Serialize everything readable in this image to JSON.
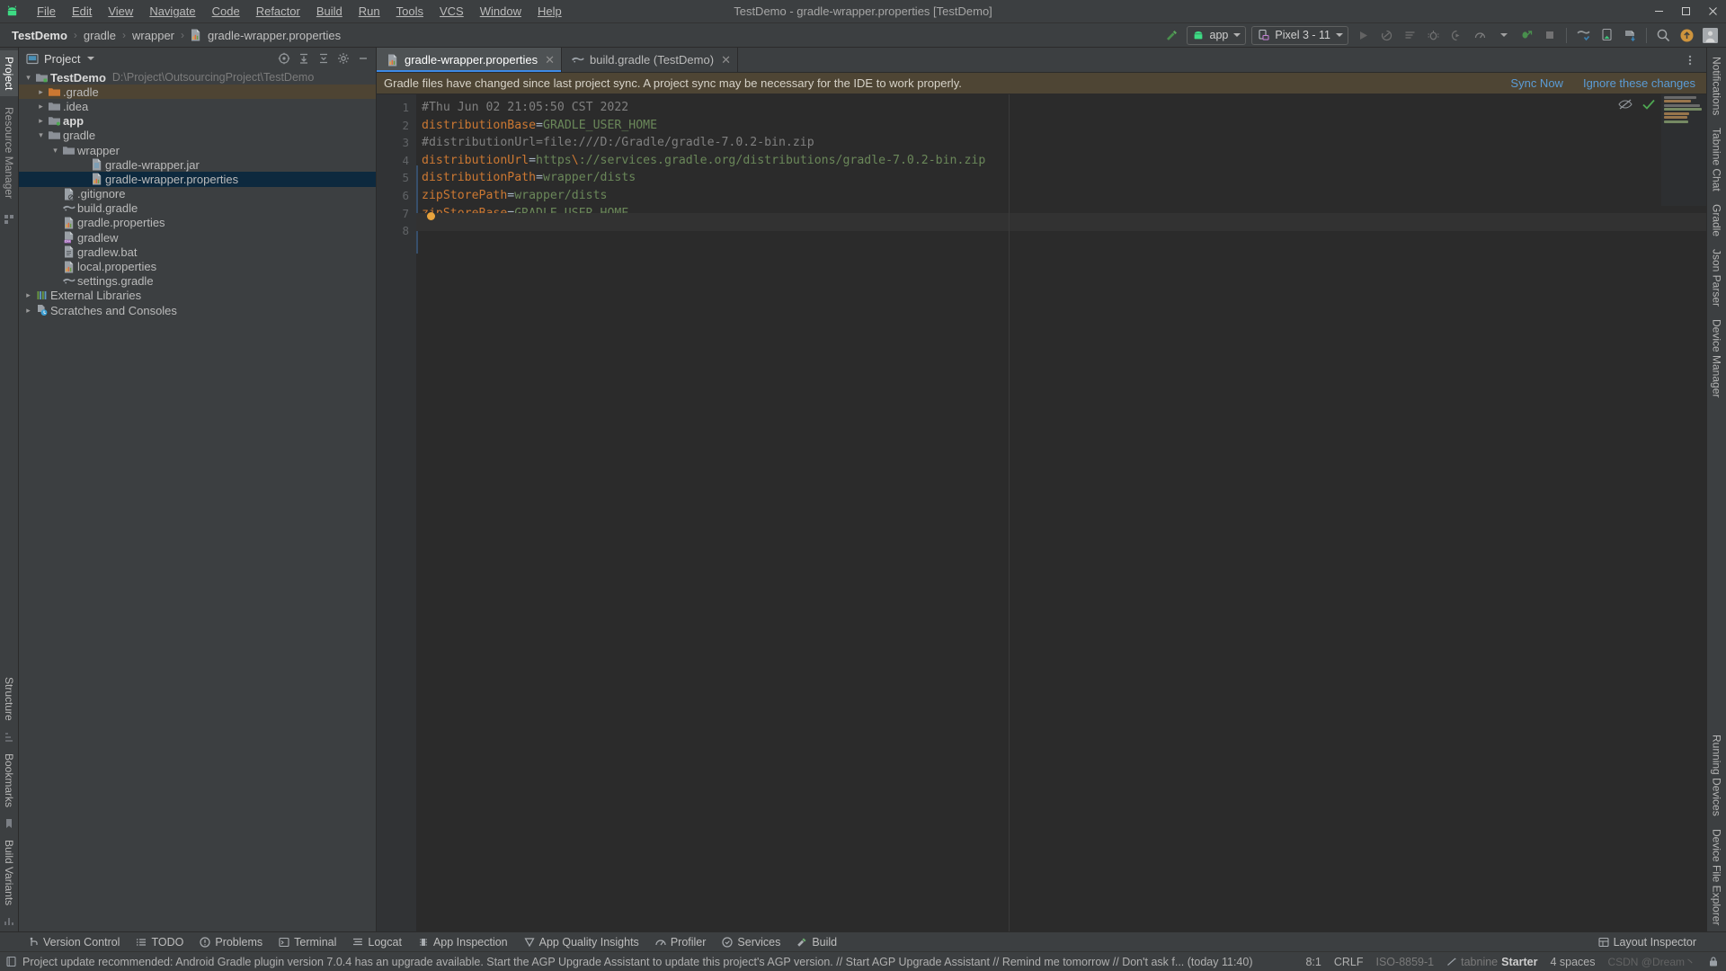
{
  "window": {
    "title": "TestDemo - gradle-wrapper.properties [TestDemo]",
    "minimize": "—",
    "maximize": "☐",
    "close": "✕"
  },
  "menu": [
    {
      "label": "File"
    },
    {
      "label": "Edit"
    },
    {
      "label": "View"
    },
    {
      "label": "Navigate"
    },
    {
      "label": "Code"
    },
    {
      "label": "Refactor"
    },
    {
      "label": "Build"
    },
    {
      "label": "Run"
    },
    {
      "label": "Tools"
    },
    {
      "label": "VCS"
    },
    {
      "label": "Window"
    },
    {
      "label": "Help"
    }
  ],
  "breadcrumb": {
    "separator": "›",
    "items": [
      {
        "label": "TestDemo",
        "bold": true
      },
      {
        "label": "gradle",
        "bold": false
      },
      {
        "label": "wrapper",
        "bold": false
      },
      {
        "label": "gradle-wrapper.properties",
        "bold": false,
        "icon": "properties-file-icon"
      }
    ]
  },
  "toolbar": {
    "build_icon": "hammer-icon",
    "run_config": {
      "label": "app",
      "icon": "android-icon"
    },
    "device": {
      "label": "Pixel 3 - 11",
      "icon": "device-icon"
    },
    "icons": [
      "run-icon",
      "apply-changes-icon",
      "apply-code-changes-icon",
      "debug-icon",
      "run-with-coverage-icon",
      "profile-icon",
      "profile-dropdown-icon",
      "attach-debugger-icon",
      "stop-icon",
      "sdk-manager-icon",
      "avd-manager-icon",
      "sync-gradle-icon",
      "search-icon",
      "update-available-icon",
      "user-avatar-icon"
    ]
  },
  "left_rail": {
    "tabs": [
      {
        "label": "Project",
        "active": true
      }
    ],
    "bottom_tabs": [
      {
        "label": "Structure"
      },
      {
        "label": "Bookmarks"
      },
      {
        "label": "Build Variants"
      }
    ]
  },
  "right_rail": {
    "tabs": [
      {
        "label": "Notifications"
      },
      {
        "label": "Tabnine Chat"
      },
      {
        "label": "Gradle"
      },
      {
        "label": "Json Parser"
      },
      {
        "label": "Device Manager"
      }
    ],
    "bottom_tabs": [
      {
        "label": "Running Devices"
      },
      {
        "label": "Device File Explorer"
      }
    ]
  },
  "project_panel": {
    "title": "Project",
    "title_icon": "project-view-icon",
    "dropdown_icon": "chevron-down-icon",
    "header_icons": [
      "select-opened-file-icon",
      "expand-all-icon",
      "collapse-all-icon",
      "settings-icon",
      "hide-icon"
    ],
    "tree": [
      {
        "depth": 0,
        "label": "TestDemo",
        "path": "D:\\Project\\OutsourcingProject\\TestDemo",
        "arrow": "open",
        "icon": "module-icon",
        "bold": true,
        "state": "normal"
      },
      {
        "depth": 1,
        "label": ".gradle",
        "arrow": "closed",
        "icon": "folder-orange-icon",
        "state": "highlighted"
      },
      {
        "depth": 1,
        "label": ".idea",
        "arrow": "closed",
        "icon": "folder-icon",
        "state": "normal"
      },
      {
        "depth": 1,
        "label": "app",
        "arrow": "closed",
        "icon": "module-folder-icon",
        "bold": true,
        "state": "normal"
      },
      {
        "depth": 1,
        "label": "gradle",
        "arrow": "open",
        "icon": "folder-icon",
        "state": "normal"
      },
      {
        "depth": 2,
        "label": "wrapper",
        "arrow": "open",
        "icon": "folder-icon",
        "state": "normal"
      },
      {
        "depth": 3,
        "label": "gradle-wrapper.jar",
        "arrow": "none",
        "icon": "jar-file-icon",
        "state": "normal"
      },
      {
        "depth": 3,
        "label": "gradle-wrapper.properties",
        "arrow": "none",
        "icon": "properties-file-icon",
        "state": "selected"
      },
      {
        "depth": 1,
        "label": ".gitignore",
        "arrow": "none",
        "icon": "gitignore-file-icon",
        "state": "normal"
      },
      {
        "depth": 1,
        "label": "build.gradle",
        "arrow": "none",
        "icon": "gradle-file-icon",
        "state": "normal"
      },
      {
        "depth": 1,
        "label": "gradle.properties",
        "arrow": "none",
        "icon": "properties-file-icon",
        "state": "normal"
      },
      {
        "depth": 1,
        "label": "gradlew",
        "arrow": "none",
        "icon": "cpp-file-icon",
        "state": "normal"
      },
      {
        "depth": 1,
        "label": "gradlew.bat",
        "arrow": "none",
        "icon": "text-file-icon",
        "state": "normal"
      },
      {
        "depth": 1,
        "label": "local.properties",
        "arrow": "none",
        "icon": "properties-file-icon",
        "state": "normal"
      },
      {
        "depth": 1,
        "label": "settings.gradle",
        "arrow": "none",
        "icon": "gradle-file-icon",
        "state": "normal"
      },
      {
        "depth": 0,
        "label": "External Libraries",
        "arrow": "closed",
        "icon": "libraries-icon",
        "state": "normal"
      },
      {
        "depth": 0,
        "label": "Scratches and Consoles",
        "arrow": "closed",
        "icon": "scratches-icon",
        "state": "normal"
      }
    ]
  },
  "editor": {
    "tabs": [
      {
        "label": "gradle-wrapper.properties",
        "icon": "properties-file-icon",
        "active": true,
        "close": "✕"
      },
      {
        "label": "build.gradle (TestDemo)",
        "icon": "gradle-file-icon",
        "active": false,
        "close": "✕"
      }
    ],
    "more_icon": "more-options-icon",
    "notification": {
      "message": "Gradle files have changed since last project sync. A project sync may be necessary for the IDE to work properly.",
      "sync_label": "Sync Now",
      "ignore_label": "Ignore these changes",
      "background": "#4e4534",
      "link_color": "#5b9cd6"
    },
    "badges": [
      "inspections-hidden-icon",
      "no-problems-icon"
    ],
    "line_count": 8,
    "lines": [
      {
        "n": 1,
        "tokens": [
          {
            "t": "#Thu Jun 02 21:05:50 CST 2022",
            "c": "c"
          }
        ]
      },
      {
        "n": 2,
        "tokens": [
          {
            "t": "distributionBase",
            "c": "k"
          },
          {
            "t": "=",
            "c": "p"
          },
          {
            "t": "GRADLE_USER_HOME",
            "c": "v"
          }
        ]
      },
      {
        "n": 3,
        "tokens": [
          {
            "t": "#distributionUrl=file:///D:/Gradle/gradle-7.0.2-bin.zip",
            "c": "c"
          }
        ]
      },
      {
        "n": 4,
        "tokens": [
          {
            "t": "distributionUrl",
            "c": "k"
          },
          {
            "t": "=",
            "c": "p"
          },
          {
            "t": "https",
            "c": "v"
          },
          {
            "t": "\\",
            "c": "esc"
          },
          {
            "t": "://services.gradle.org/distributions/gradle-7.0.2-bin.zip",
            "c": "v"
          }
        ]
      },
      {
        "n": 5,
        "tokens": [
          {
            "t": "distributionPath",
            "c": "k"
          },
          {
            "t": "=",
            "c": "p"
          },
          {
            "t": "wrapper/dists",
            "c": "v"
          }
        ]
      },
      {
        "n": 6,
        "tokens": [
          {
            "t": "zipStorePath",
            "c": "k"
          },
          {
            "t": "=",
            "c": "p"
          },
          {
            "t": "wrapper/dists",
            "c": "v"
          }
        ]
      },
      {
        "n": 7,
        "tokens": [
          {
            "t": "zipStoreBase",
            "c": "k"
          },
          {
            "t": "=",
            "c": "p"
          },
          {
            "t": "GRADLE_USER_HOME",
            "c": "v"
          }
        ]
      },
      {
        "n": 8,
        "tokens": []
      }
    ],
    "colors": {
      "background": "#2b2b2b",
      "gutter": "#313335",
      "key": "#cc7832",
      "value": "#6a8759",
      "comment": "#808080",
      "text": "#a9b7c6",
      "caret_row": "#323232"
    }
  },
  "bottom_tools": [
    {
      "label": "Version Control",
      "icon": "version-control-icon"
    },
    {
      "label": "TODO",
      "icon": "todo-icon"
    },
    {
      "label": "Problems",
      "icon": "problems-icon"
    },
    {
      "label": "Terminal",
      "icon": "terminal-icon"
    },
    {
      "label": "Logcat",
      "icon": "logcat-icon"
    },
    {
      "label": "App Inspection",
      "icon": "app-inspection-icon"
    },
    {
      "label": "App Quality Insights",
      "icon": "app-quality-insights-icon"
    },
    {
      "label": "Profiler",
      "icon": "profiler-icon"
    },
    {
      "label": "Services",
      "icon": "services-icon"
    },
    {
      "label": "Build",
      "icon": "build-icon"
    }
  ],
  "bottom_right": {
    "layout_inspector": {
      "label": "Layout Inspector",
      "icon": "layout-inspector-icon"
    }
  },
  "status_bar": {
    "icon": "event-log-icon",
    "message": "Project update recommended: Android Gradle plugin version 7.0.4 has an upgrade available.  Start the AGP Upgrade Assistant to update this project's AGP version. // Start AGP Upgrade Assistant // Remind me tomorrow // Don't ask f... (today 11:40)",
    "caret_position": "8:1",
    "line_separator": "CRLF",
    "encoding": "ISO-8859-1",
    "plugin": {
      "name": "tabnine",
      "tier": "Starter",
      "icon": "tabnine-icon"
    },
    "indent": "4 spaces",
    "watermark": "CSDN @Dream丶",
    "lock_icon": "read-only-icon"
  }
}
